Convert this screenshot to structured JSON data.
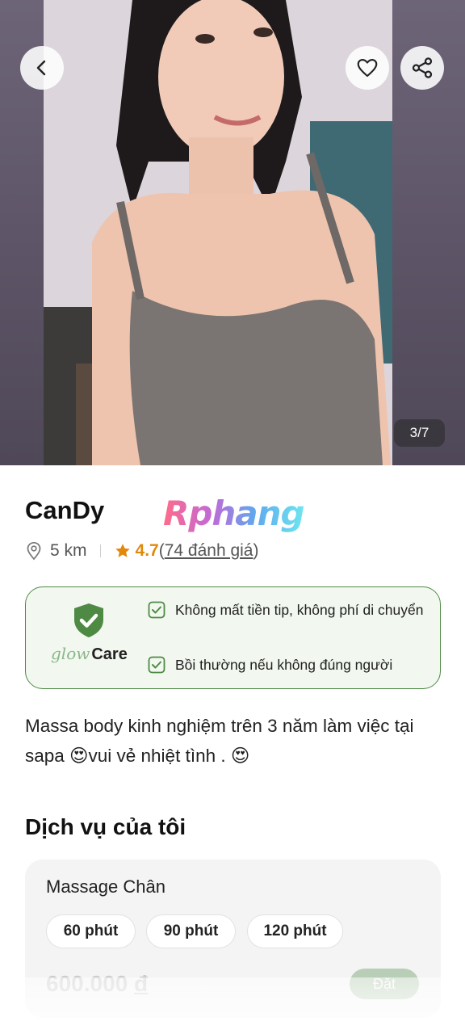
{
  "gallery": {
    "counter": "3/7",
    "back_icon": "chevron-left-icon",
    "favorite_icon": "heart-icon",
    "share_icon": "share-icon"
  },
  "profile": {
    "name": "CanDy",
    "watermark": "Rphang",
    "distance": "5 km",
    "rating": "4.7",
    "reviews_open": "(",
    "reviews": "74 đánh giá",
    "reviews_close": ")"
  },
  "care": {
    "logo_glow": "glow",
    "logo_care": "Care",
    "features": [
      "Không mất tiền tip, không phí di chuyển",
      "Bồi thường nếu không đúng người"
    ]
  },
  "bio": "Massa body kinh nghiệm trên 3 năm làm việc tại sapa 😍vui vẻ nhiệt tình . 😍",
  "services": {
    "title": "Dịch vụ của tôi",
    "items": [
      {
        "name": "Massage Chân",
        "durations": [
          "60 phút",
          "90 phút",
          "120 phút"
        ],
        "price": "600.000",
        "currency": "đ",
        "book_label": "Đặt"
      }
    ]
  },
  "colors": {
    "accent_green": "#4f8a45",
    "rating_orange": "#e2890c"
  }
}
